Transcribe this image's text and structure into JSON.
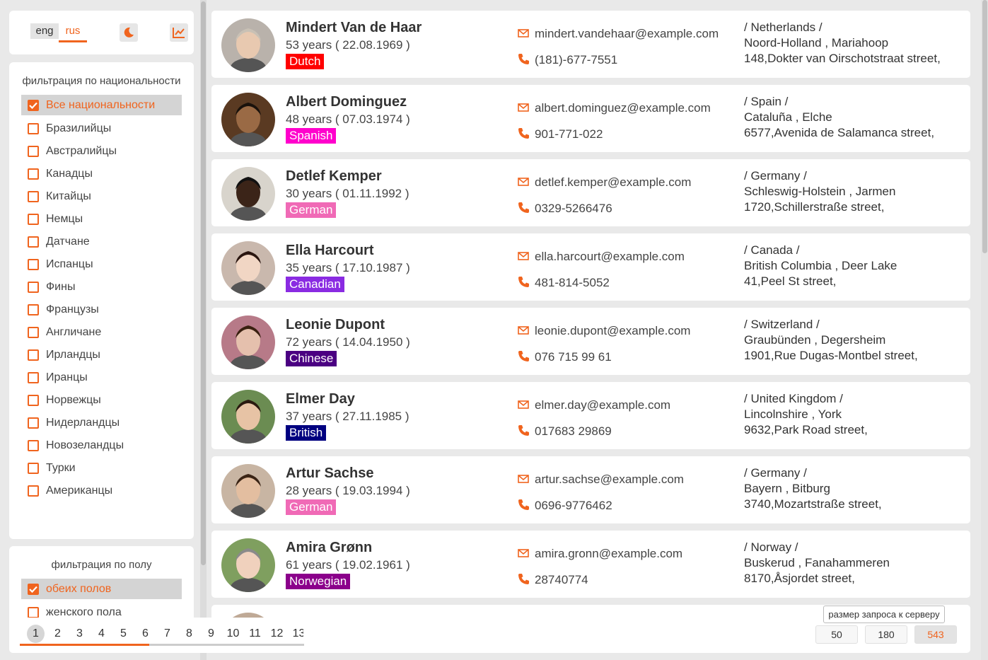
{
  "header": {
    "languages": [
      "eng",
      "rus"
    ],
    "active_language": "rus",
    "theme_icon": "moon-icon",
    "stats_icon": "chart-icon"
  },
  "nat_filter": {
    "title": "фильтрация по национальности",
    "items": [
      {
        "label": "Все национальности",
        "checked": true
      },
      {
        "label": "Бразилийцы",
        "checked": false
      },
      {
        "label": "Австралийцы",
        "checked": false
      },
      {
        "label": "Канадцы",
        "checked": false
      },
      {
        "label": "Китайцы",
        "checked": false
      },
      {
        "label": "Немцы",
        "checked": false
      },
      {
        "label": "Датчане",
        "checked": false
      },
      {
        "label": "Испанцы",
        "checked": false
      },
      {
        "label": "Фины",
        "checked": false
      },
      {
        "label": "Французы",
        "checked": false
      },
      {
        "label": "Англичане",
        "checked": false
      },
      {
        "label": "Ирландцы",
        "checked": false
      },
      {
        "label": "Иранцы",
        "checked": false
      },
      {
        "label": "Норвежцы",
        "checked": false
      },
      {
        "label": "Нидерландцы",
        "checked": false
      },
      {
        "label": "Новозеландцы",
        "checked": false
      },
      {
        "label": "Турки",
        "checked": false
      },
      {
        "label": "Американцы",
        "checked": false
      }
    ]
  },
  "gender_filter": {
    "title": "фильтрация по полу",
    "items": [
      {
        "label": "обеих полов",
        "checked": true
      },
      {
        "label": "женского пола",
        "checked": false
      }
    ]
  },
  "users": [
    {
      "name": "Mindert Van de Haar",
      "age": "53 years ( 22.08.1969 )",
      "nationality": "Dutch",
      "badge_color": "#ff0000",
      "email": "mindert.vandehaar@example.com",
      "phone": "(181)-677-7551",
      "country": "/ Netherlands /",
      "region": "Noord-Holland , Mariahoop",
      "street": "148,Dokter van Oirschotstraat street,"
    },
    {
      "name": "Albert Dominguez",
      "age": "48 years ( 07.03.1974 )",
      "nationality": "Spanish",
      "badge_color": "#ff00cc",
      "email": "albert.dominguez@example.com",
      "phone": "901-771-022",
      "country": "/ Spain /",
      "region": "Cataluña , Elche",
      "street": "6577,Avenida de Salamanca street,"
    },
    {
      "name": "Detlef Kemper",
      "age": "30 years ( 01.11.1992 )",
      "nationality": "German",
      "badge_color": "#f06ab6",
      "email": "detlef.kemper@example.com",
      "phone": "0329-5266476",
      "country": "/ Germany /",
      "region": "Schleswig-Holstein , Jarmen",
      "street": "1720,Schillerstraße street,"
    },
    {
      "name": "Ella Harcourt",
      "age": "35 years ( 17.10.1987 )",
      "nationality": "Canadian",
      "badge_color": "#8a2be2",
      "email": "ella.harcourt@example.com",
      "phone": "481-814-5052",
      "country": "/ Canada /",
      "region": "British Columbia , Deer Lake",
      "street": "41,Peel St street,"
    },
    {
      "name": "Leonie Dupont",
      "age": "72 years ( 14.04.1950 )",
      "nationality": "Chinese",
      "badge_color": "#4b0082",
      "email": "leonie.dupont@example.com",
      "phone": "076 715 99 61",
      "country": "/ Switzerland /",
      "region": "Graubünden , Degersheim",
      "street": "1901,Rue Dugas-Montbel street,"
    },
    {
      "name": "Elmer Day",
      "age": "37 years ( 27.11.1985 )",
      "nationality": "British",
      "badge_color": "#000080",
      "email": "elmer.day@example.com",
      "phone": "017683 29869",
      "country": "/ United Kingdom /",
      "region": "Lincolnshire , York",
      "street": "9632,Park Road street,"
    },
    {
      "name": "Artur Sachse",
      "age": "28 years ( 19.03.1994 )",
      "nationality": "German",
      "badge_color": "#f06ab6",
      "email": "artur.sachse@example.com",
      "phone": "0696-9776462",
      "country": "/ Germany /",
      "region": "Bayern , Bitburg",
      "street": "3740,Mozartstraße street,"
    },
    {
      "name": "Amira Grønn",
      "age": "61 years ( 19.02.1961 )",
      "nationality": "Norwegian",
      "badge_color": "#8b008b",
      "email": "amira.gronn@example.com",
      "phone": "28740774",
      "country": "/ Norway /",
      "region": "Buskerud , Fanahammeren",
      "street": "8170,Åsjordet street,"
    }
  ],
  "pagination": {
    "pages": [
      "1",
      "2",
      "3",
      "4",
      "5",
      "6",
      "7",
      "8",
      "9",
      "10",
      "11",
      "12",
      "13"
    ],
    "active": "1"
  },
  "request_size": {
    "tooltip": "размер запроса к серверу",
    "options": [
      "50",
      "180",
      "543"
    ],
    "active": "543"
  },
  "colors": {
    "accent": "#f0641e"
  }
}
